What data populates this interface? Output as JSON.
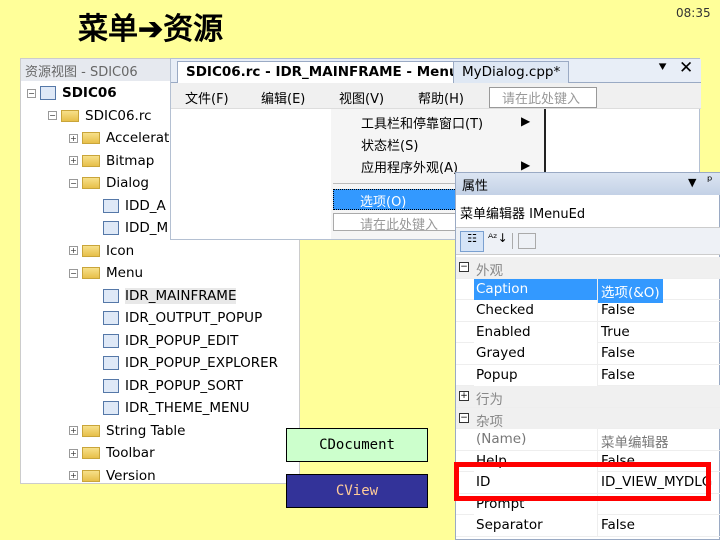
{
  "slide": {
    "title": "菜单",
    "arrow": "➔",
    "title2": "资源",
    "time": "08:35"
  },
  "colors": {
    "background": "#FFFF99",
    "selection": "#3399FF",
    "highlight_box": "#FF0000",
    "cdocument_fill": "#CCFFCC",
    "cview_fill": "#333399",
    "cview_text": "#FFCC99"
  },
  "tree": {
    "header": "资源视图 - SDIC06",
    "items": [
      {
        "label": "SDIC06",
        "bold": true,
        "depth": 0,
        "toggle": "−",
        "icon": "project"
      },
      {
        "label": "SDIC06.rc",
        "depth": 1,
        "toggle": "−",
        "icon": "folder"
      },
      {
        "label": "Accelerat",
        "depth": 2,
        "toggle": "+",
        "icon": "folder"
      },
      {
        "label": "Bitmap",
        "depth": 2,
        "toggle": "+",
        "icon": "folder"
      },
      {
        "label": "Dialog",
        "depth": 2,
        "toggle": "−",
        "icon": "folder"
      },
      {
        "label": "IDD_A",
        "depth": 3,
        "icon": "dialog"
      },
      {
        "label": "IDD_M",
        "depth": 3,
        "icon": "dialog"
      },
      {
        "label": "Icon",
        "depth": 2,
        "toggle": "+",
        "icon": "folder"
      },
      {
        "label": "Menu",
        "depth": 2,
        "toggle": "−",
        "icon": "folder"
      },
      {
        "label": "IDR_MAINFRAME",
        "depth": 3,
        "icon": "menu",
        "selected": true
      },
      {
        "label": "IDR_OUTPUT_POPUP",
        "depth": 3,
        "icon": "menu"
      },
      {
        "label": "IDR_POPUP_EDIT",
        "depth": 3,
        "icon": "menu"
      },
      {
        "label": "IDR_POPUP_EXPLORER",
        "depth": 3,
        "icon": "menu"
      },
      {
        "label": "IDR_POPUP_SORT",
        "depth": 3,
        "icon": "menu"
      },
      {
        "label": "IDR_THEME_MENU",
        "depth": 3,
        "icon": "menu"
      },
      {
        "label": "String Table",
        "depth": 2,
        "toggle": "+",
        "icon": "folder"
      },
      {
        "label": "Toolbar",
        "depth": 2,
        "toggle": "+",
        "icon": "folder"
      },
      {
        "label": "Version",
        "depth": 2,
        "toggle": "+",
        "icon": "folder"
      }
    ]
  },
  "editor": {
    "tabs": [
      "SDIC06.rc - IDR_MAINFRAME - Menu*",
      "MyDialog.cpp*"
    ],
    "menubar": [
      "文件(F)",
      "编辑(E)",
      "视图(V)",
      "帮助(H)"
    ],
    "type_here": "请在此处键入",
    "dropdown": [
      {
        "label": "工具栏和停靠窗口(T)",
        "submenu": true
      },
      {
        "label": "状态栏(S)"
      },
      {
        "label": "应用程序外观(A)",
        "submenu": true
      }
    ],
    "selected_item": "选项(O)",
    "dropdown_type_here": "请在此处键入"
  },
  "properties": {
    "title": "属性",
    "object": "菜单编辑器 IMenuEd",
    "rows": [
      {
        "category": "外观",
        "toggle": "−"
      },
      {
        "name": "Caption",
        "value": "选项(&O)",
        "selected": true
      },
      {
        "name": "Checked",
        "value": "False"
      },
      {
        "name": "Enabled",
        "value": "True"
      },
      {
        "name": "Grayed",
        "value": "False"
      },
      {
        "name": "Popup",
        "value": "False"
      },
      {
        "category": "行为",
        "toggle": "+"
      },
      {
        "category": "杂项",
        "toggle": "−"
      },
      {
        "name": "(Name)",
        "value": "菜单编辑器",
        "gray": true
      },
      {
        "name": "Help",
        "value": "False"
      },
      {
        "name": "ID",
        "value": "ID_VIEW_MYDLG",
        "highlighted": true
      },
      {
        "name": "Prompt",
        "value": ""
      },
      {
        "name": "Separator",
        "value": "False"
      }
    ]
  },
  "boxes": {
    "cdocument": "CDocument",
    "cview": "CView"
  }
}
